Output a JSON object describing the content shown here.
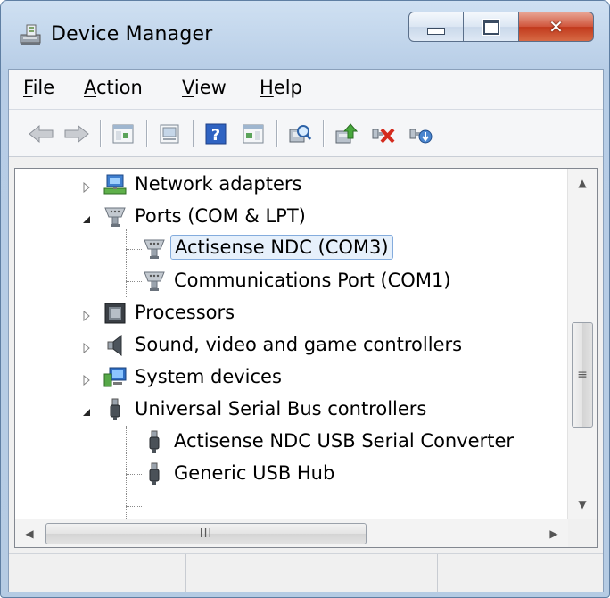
{
  "window": {
    "title": "Device Manager"
  },
  "menu": [
    {
      "label_first": "F",
      "label_rest": "ile"
    },
    {
      "label_first": "A",
      "label_rest": "ction"
    },
    {
      "label_first": "V",
      "label_rest": "iew"
    },
    {
      "label_first": "H",
      "label_rest": "elp"
    }
  ],
  "toolbar": {
    "buttons": [
      "back-icon",
      "forward-icon",
      "show-hide-console-tree-icon",
      "properties-icon",
      "help-icon",
      "show-hide-action-pane-icon",
      "scan-hardware-icon",
      "update-driver-icon",
      "uninstall-device-icon",
      "disable-device-icon"
    ]
  },
  "tree": {
    "items": [
      {
        "label": "Network adapters",
        "icon": "network-adapter-icon",
        "expander": "collapsed"
      },
      {
        "label": "Ports (COM & LPT)",
        "icon": "port-icon",
        "expander": "expanded"
      },
      {
        "label": "Actisense NDC (COM3)",
        "icon": "port-icon",
        "selected": true
      },
      {
        "label": "Communications Port (COM1)",
        "icon": "port-icon"
      },
      {
        "label": "Processors",
        "icon": "processor-icon",
        "expander": "collapsed"
      },
      {
        "label": "Sound, video and game controllers",
        "icon": "speaker-icon",
        "expander": "collapsed"
      },
      {
        "label": "System devices",
        "icon": "system-device-icon",
        "expander": "collapsed"
      },
      {
        "label": "Universal Serial Bus controllers",
        "icon": "usb-icon",
        "expander": "expanded"
      },
      {
        "label": "Actisense NDC USB Serial Converter",
        "icon": "usb-icon"
      },
      {
        "label": "Generic USB Hub",
        "icon": "usb-icon"
      }
    ]
  },
  "scrollbars": {
    "horizontal_thumb_grip": "III"
  }
}
